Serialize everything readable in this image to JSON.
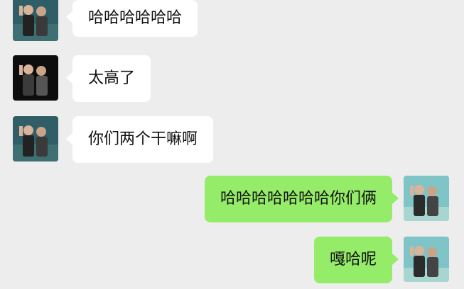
{
  "chat": {
    "messages": [
      {
        "side": "incoming",
        "text": "哈哈哈哈哈哈",
        "avatar": "group-photo-avatar"
      },
      {
        "side": "incoming",
        "text": "太高了",
        "avatar": "group-photo-avatar-dark"
      },
      {
        "side": "incoming",
        "text": "你们两个干嘛啊",
        "avatar": "group-photo-avatar"
      },
      {
        "side": "outgoing",
        "text": "哈哈哈哈哈哈哈你们俩",
        "avatar": "group-photo-avatar-light"
      },
      {
        "side": "outgoing",
        "text": "嘎哈呢",
        "avatar": "group-photo-avatar-light"
      }
    ]
  },
  "colors": {
    "background": "#ededed",
    "incoming_bubble": "#ffffff",
    "outgoing_bubble": "#95ec69"
  }
}
